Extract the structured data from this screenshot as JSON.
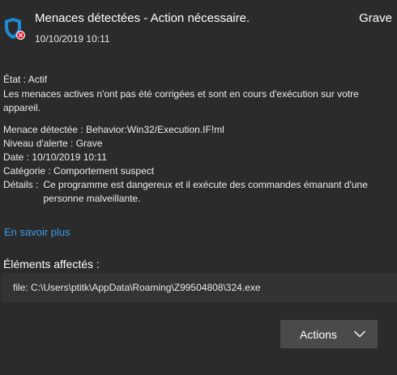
{
  "header": {
    "title": "Menaces détectées - Action nécessaire.",
    "severity": "Grave",
    "timestamp": "10/10/2019 10:11",
    "icon": "shield-error-icon"
  },
  "status": {
    "label": "État :",
    "value": "Actif",
    "description": "Les menaces actives n'ont pas été corrigées et sont en cours d'exécution sur votre appareil."
  },
  "details": {
    "threat_label": "Menace détectée :",
    "threat_value": "Behavior:Win32/Execution.IF!ml",
    "alert_label": "Niveau d'alerte :",
    "alert_value": "Grave",
    "date_label": "Date :",
    "date_value": "10/10/2019 10:11",
    "category_label": "Catégorie :",
    "category_value": "Comportement suspect",
    "info_label": "Détails :",
    "info_value": "Ce programme est dangereux et il exécute des commandes émanant d'une personne malveillante."
  },
  "learn_more": "En savoir plus",
  "affected": {
    "title": "Éléments affectés :",
    "file": "file: C:\\Users\\ptitk\\AppData\\Roaming\\Z99504808\\324.exe"
  },
  "actions": {
    "label": "Actions",
    "icon": "chevron-down-icon"
  },
  "colors": {
    "background": "#2b2b2b",
    "link": "#3a9be8",
    "shield": "#1e8ad6",
    "error_badge": "#e81123",
    "button": "#4a4a4a"
  }
}
